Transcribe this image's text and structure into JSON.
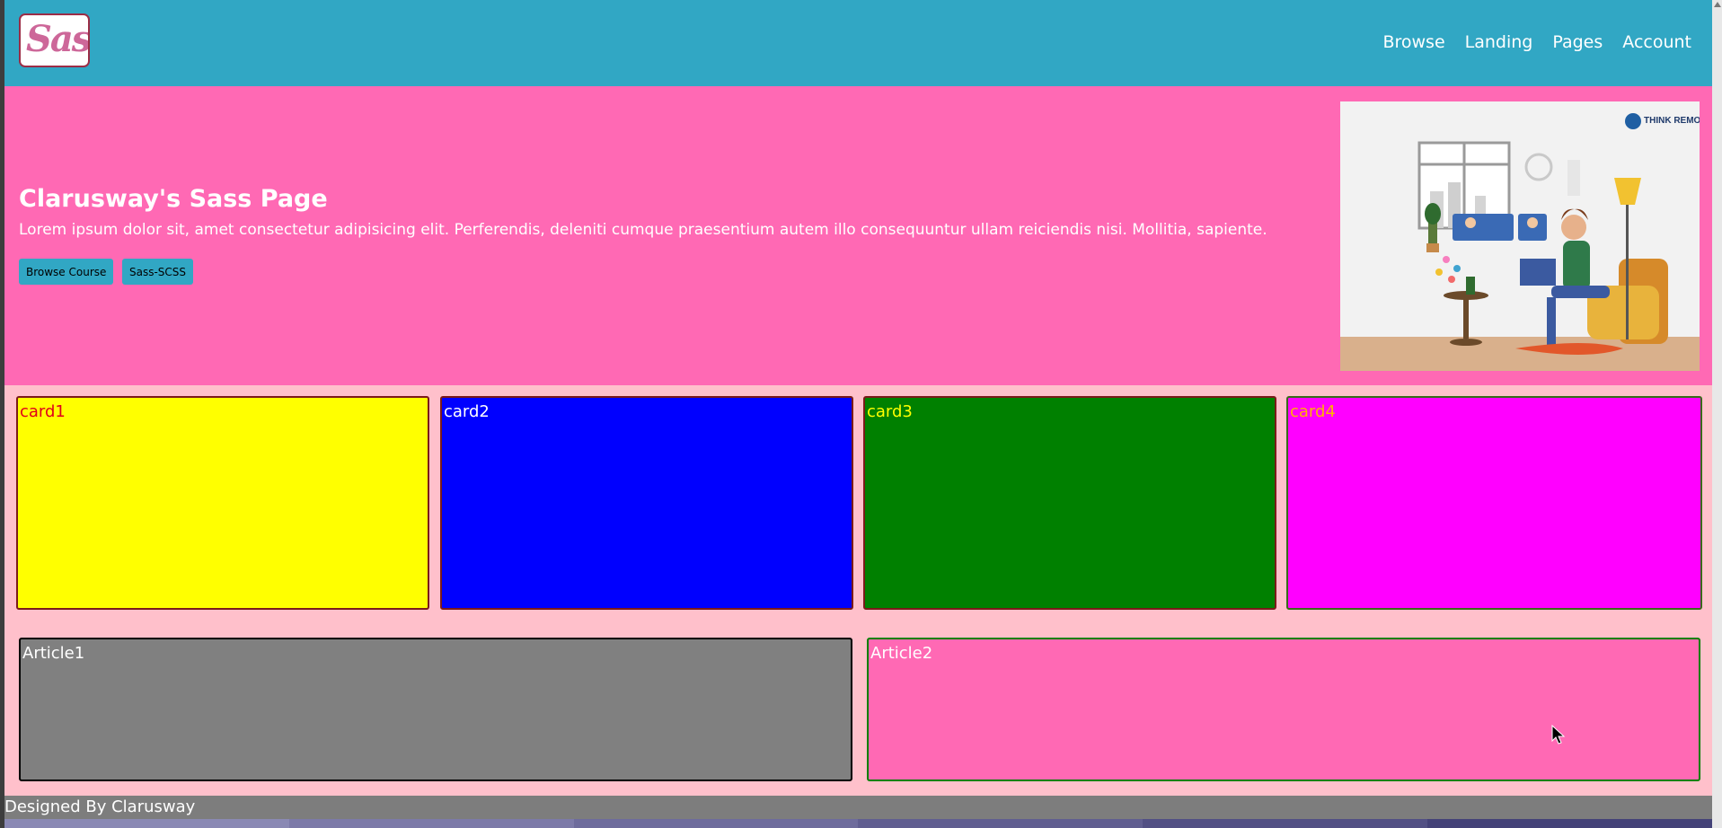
{
  "navbar": {
    "logo_text": "Sass",
    "links": [
      "Browse",
      "Landing",
      "Pages",
      "Account"
    ]
  },
  "hero": {
    "title": "Clarusway's Sass Page",
    "text": "Lorem ipsum dolor sit, amet consectetur adipisicing elit. Perferendis, deleniti cumque praesentium autem illo consequuntur ullam reiciendis nisi. Mollitia, sapiente.",
    "buttons": [
      "Browse Course",
      "Sass-SCSS"
    ],
    "image_logo_text": "THINK REMOTE"
  },
  "cards": [
    {
      "label": "card1",
      "bg": "#ffff00",
      "color": "#e0001a",
      "border": "#7b1a1a"
    },
    {
      "label": "card2",
      "bg": "#0000ff",
      "color": "#ffffff",
      "border": "#7b1a1a"
    },
    {
      "label": "card3",
      "bg": "#008000",
      "color": "#ffff00",
      "border": "#7b1a1a"
    },
    {
      "label": "card4",
      "bg": "#ff00ff",
      "color": "#ffb300",
      "border": "#3a6a1a"
    }
  ],
  "articles": [
    {
      "label": "Article1",
      "bg": "#808080",
      "border": "#000000"
    },
    {
      "label": "Article2",
      "bg": "#ff69b4",
      "border": "#008000"
    }
  ],
  "footer": {
    "text": "Designed By Clarusway"
  },
  "colors": {
    "navbar": "#31a7c4",
    "hero": "#ff69b4",
    "page_bg": "#ffc0cb",
    "footer": "#7d7d7d",
    "taskbar": [
      "#8a89b4",
      "#7c7aa8",
      "#6e6c9c",
      "#605e90",
      "#525084",
      "#444278"
    ]
  }
}
